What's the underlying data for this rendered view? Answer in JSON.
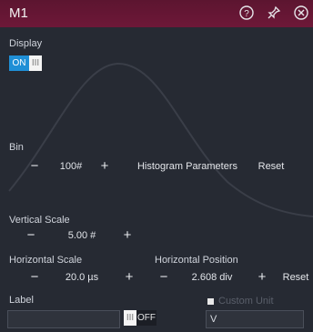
{
  "window": {
    "title": "M1",
    "help_icon": "help-circle-icon",
    "pin_icon": "pin-icon",
    "close_icon": "close-circle-icon"
  },
  "display": {
    "label": "Display",
    "toggle_on": "ON",
    "toggle_handle": "III"
  },
  "bin": {
    "label": "Bin",
    "value": "100#",
    "minus": "−",
    "plus": "+",
    "histogram_button": "Histogram Parameters",
    "reset_button": "Reset"
  },
  "vertical_scale": {
    "label": "Vertical Scale",
    "value": "5.00 #",
    "minus": "−",
    "plus": "+"
  },
  "horizontal_scale": {
    "label": "Horizontal Scale",
    "value": "20.0 µs",
    "minus": "−",
    "plus": "+"
  },
  "horizontal_position": {
    "label": "Horizontal Position",
    "value": "2.608 div",
    "minus": "−",
    "plus": "+",
    "reset_button": "Reset"
  },
  "label_section": {
    "label": "Label",
    "input_value": "",
    "toggle_handle": "III",
    "toggle_off": "OFF",
    "custom_unit_label": "Custom Unit",
    "unit_value": "V"
  },
  "colors": {
    "titlebar": "#6e1838",
    "accent": "#1f8fd6",
    "background": "#262a33"
  }
}
